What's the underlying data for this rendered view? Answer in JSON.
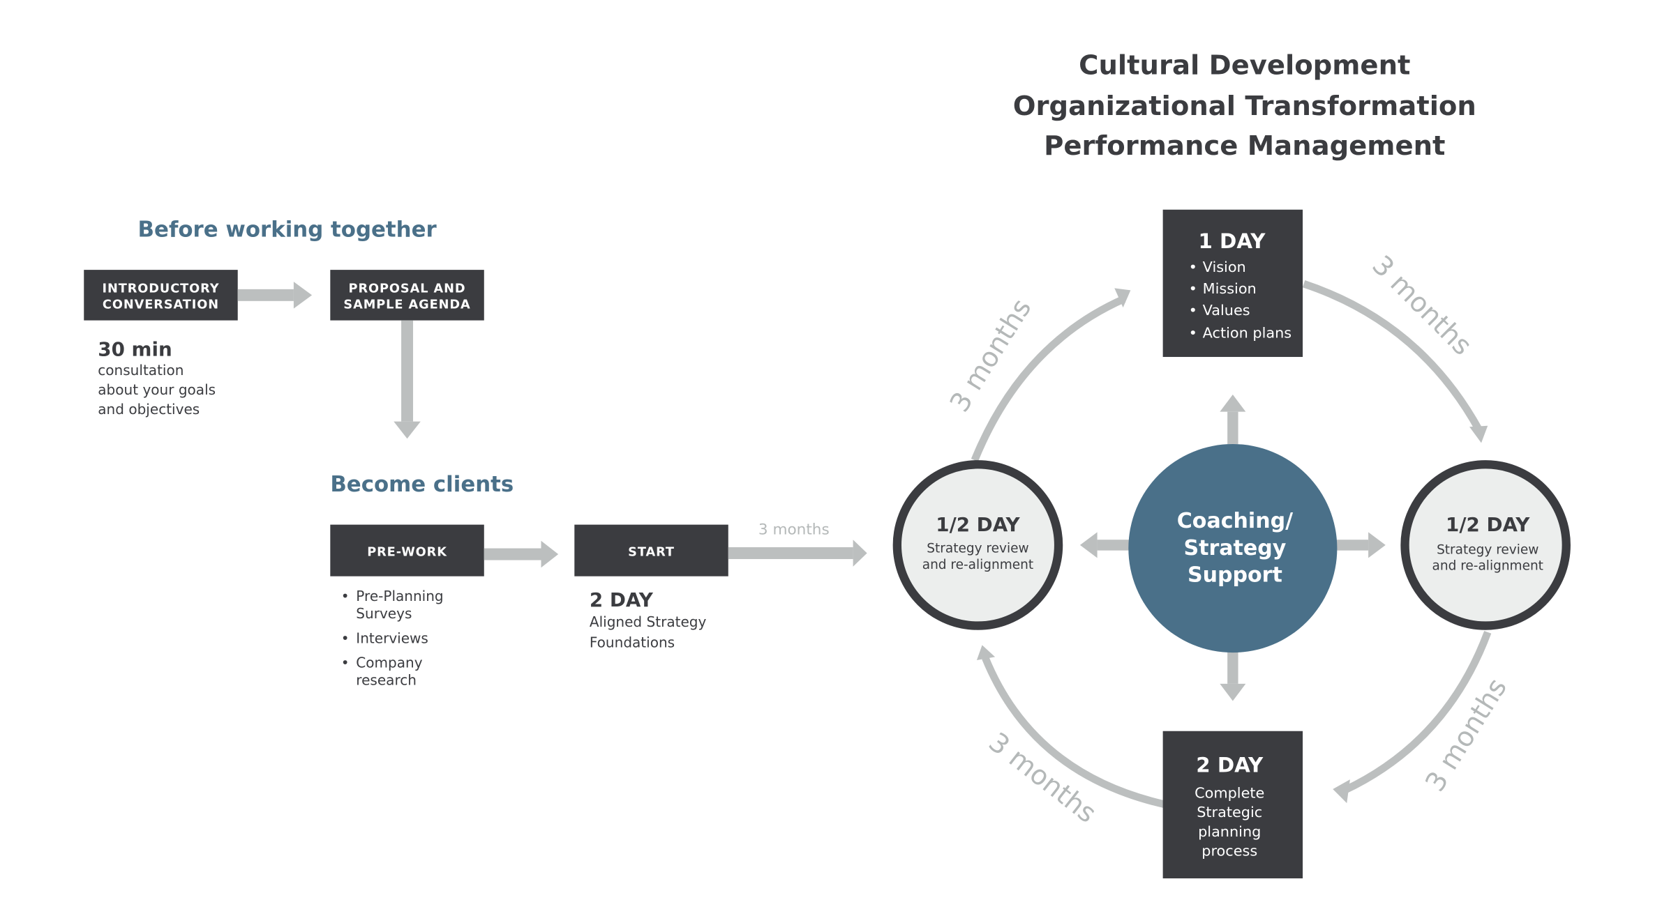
{
  "header": {
    "lines": [
      "Cultural Development",
      "Organizational Transformation",
      "Performance Management"
    ]
  },
  "before": {
    "title": "Before working together",
    "intro_box": [
      "INTRODUCTORY",
      "CONVERSATION"
    ],
    "proposal_box": [
      "PROPOSAL AND",
      "SAMPLE AGENDA"
    ],
    "duration": "30 min",
    "description": [
      "consultation",
      "about your goals",
      "and objectives"
    ]
  },
  "clients": {
    "title": "Become clients",
    "prework_box": "PRE-WORK",
    "prework_items": [
      [
        "Pre-Planning",
        "Surveys"
      ],
      [
        "Interviews"
      ],
      [
        "Company",
        "research"
      ]
    ],
    "start_box": "START",
    "start_duration": "2 DAY",
    "start_description": [
      "Aligned Strategy",
      "Foundations"
    ],
    "transition_label": "3 months"
  },
  "cycle": {
    "top": {
      "title": "1 DAY",
      "items": [
        "Vision",
        "Mission",
        "Values",
        "Action plans"
      ]
    },
    "left": {
      "title": "1/2 DAY",
      "sub": [
        "Strategy review",
        "and re-alignment"
      ]
    },
    "right": {
      "title": "1/2 DAY",
      "sub": [
        "Strategy review",
        "and re-alignment"
      ]
    },
    "bottom": {
      "title": "2 DAY",
      "sub": [
        "Complete",
        "Strategic",
        "planning",
        "process"
      ]
    },
    "center": [
      "Coaching/",
      "Strategy",
      "Support"
    ],
    "arc_labels": [
      "3 months",
      "3 months",
      "3 months",
      "3 months"
    ]
  },
  "colors": {
    "dark": "#3b3c40",
    "accent_blue": "#4a7089",
    "arrow_gray": "#bcbfbf",
    "circle_fill": "#eceeed"
  }
}
